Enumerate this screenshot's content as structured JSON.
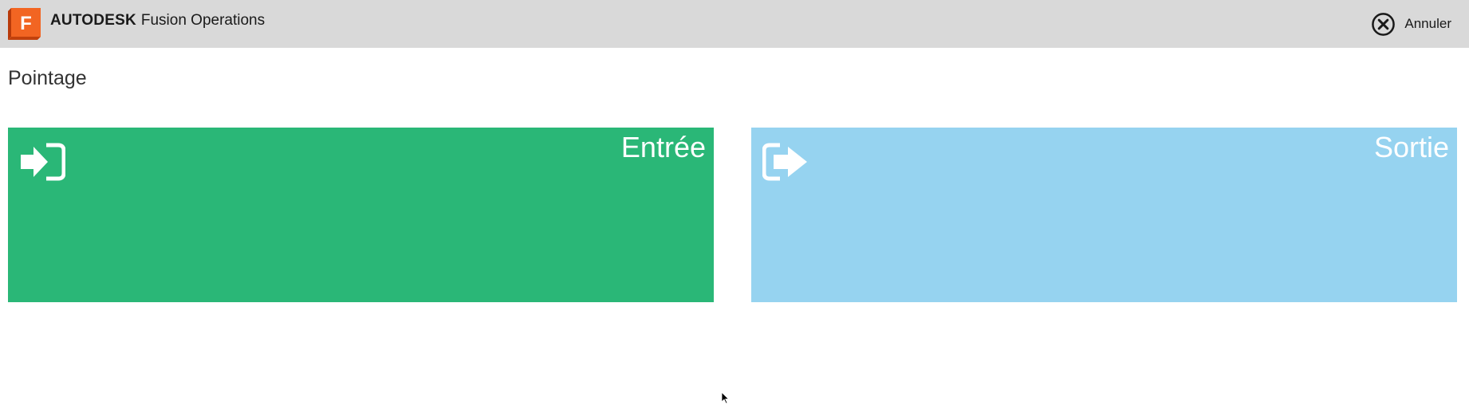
{
  "header": {
    "logo_letter": "F",
    "brand_name": "AUTODESK",
    "product_name": "Fusion Operations",
    "cancel_label": "Annuler",
    "cancel_icon": "circle-x-icon"
  },
  "page": {
    "title": "Pointage"
  },
  "tiles": [
    {
      "label": "Entrée",
      "icon": "sign-in-icon",
      "color": "#2ab777"
    },
    {
      "label": "Sortie",
      "icon": "sign-out-icon",
      "color": "#96d3f0"
    }
  ],
  "colors": {
    "header_bg": "#d9d9d9",
    "logo_orange": "#f26522",
    "logo_dark_orange": "#c2410c"
  }
}
